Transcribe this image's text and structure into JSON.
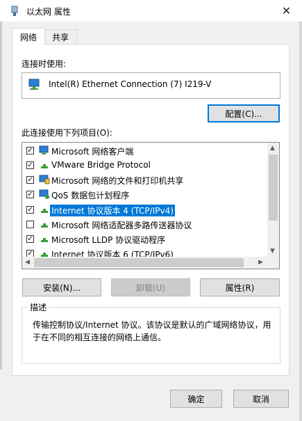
{
  "window": {
    "title": "以太网 属性"
  },
  "tabs": [
    "网络",
    "共享"
  ],
  "connect_using_label": "连接时使用:",
  "adapter_name": "Intel(R) Ethernet Connection (7) I219-V",
  "configure_button": "配置(C)...",
  "items_label": "此连接使用下列项目(O):",
  "items": [
    {
      "label": "Microsoft 网络客户端",
      "checked": true,
      "icon": "network-client-icon"
    },
    {
      "label": "VMware Bridge Protocol",
      "checked": true,
      "icon": "protocol-icon"
    },
    {
      "label": "Microsoft 网络的文件和打印机共享",
      "checked": true,
      "icon": "file-share-icon"
    },
    {
      "label": "QoS 数据包计划程序",
      "checked": true,
      "icon": "qos-icon"
    },
    {
      "label": "Internet 协议版本 4 (TCP/IPv4)",
      "checked": true,
      "icon": "protocol-icon",
      "selected": true
    },
    {
      "label": "Microsoft 网络适配器多路传送器协议",
      "checked": false,
      "icon": "protocol-icon"
    },
    {
      "label": "Microsoft LLDP 协议驱动程序",
      "checked": true,
      "icon": "protocol-icon"
    },
    {
      "label": "Internet 协议版本 6 (TCP/IPv6)",
      "checked": true,
      "icon": "protocol-icon"
    }
  ],
  "action_buttons": {
    "install": "安装(N)...",
    "uninstall": "卸载(U)",
    "properties": "属性(R)"
  },
  "description": {
    "title": "描述",
    "text": "传输控制协议/Internet 协议。该协议是默认的广域网络协议，用于在不同的相互连接的网络上通信。"
  },
  "footer": {
    "ok": "确定",
    "cancel": "取消"
  },
  "colors": {
    "accent": "#0078d7"
  }
}
